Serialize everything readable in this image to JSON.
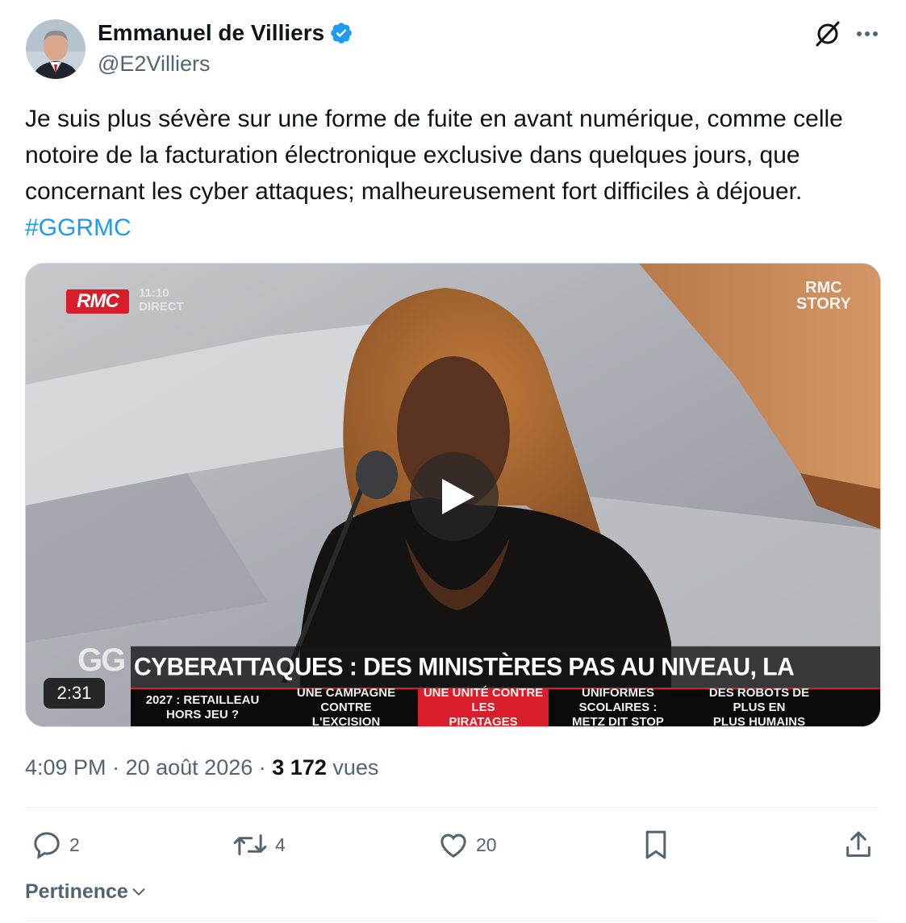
{
  "author": {
    "name": "Emmanuel de Villiers",
    "handle": "@E2Villiers",
    "verified": true
  },
  "header_icons": [
    "grok-icon",
    "more-options-icon"
  ],
  "tweet": {
    "text": "Je suis plus sévère sur une forme de fuite en avant numérique, comme celle notoire de la facturation électronique exclusive dans quelques jours, que concernant les cyber attaques; malheureusement fort difficiles à déjouer. ",
    "hashtag": "#GGRMC"
  },
  "media": {
    "type": "video",
    "duration": "2:31",
    "channel_logo": "RMC",
    "channel_time": "11:10",
    "channel_live": "DIRECT",
    "corner_logo_line1": "RMC",
    "corner_logo_line2": "STORY",
    "show_logo": "GG",
    "headline": "CYBERATTAQUES : DES MINISTÈRES PAS AU NIVEAU, LA HONTE ?",
    "ticker": [
      {
        "text": "2027 : RETAILLEAU\nHORS JEU ?",
        "active": false
      },
      {
        "text": "UNE CAMPAGNE CONTRE\nL'EXCISION",
        "active": false
      },
      {
        "text": "UNE UNITÉ CONTRE LES\nPIRATAGES",
        "active": true
      },
      {
        "text": "UNIFORMES SCOLAIRES :\nMETZ DIT STOP",
        "active": false
      },
      {
        "text": "DES ROBOTS DE PLUS EN\nPLUS HUMAINS",
        "active": false
      }
    ]
  },
  "meta": {
    "time": "4:09 PM",
    "sep": "·",
    "date": "20 août 2026",
    "views_count": "3 172",
    "views_label": "vues"
  },
  "actions": {
    "replies": "2",
    "reposts": "4",
    "likes": "20"
  },
  "sort": {
    "label": "Pertinence"
  },
  "colors": {
    "accent": "#1d9bf0",
    "text_secondary": "#536471",
    "rmc_red": "#d81e2a"
  }
}
